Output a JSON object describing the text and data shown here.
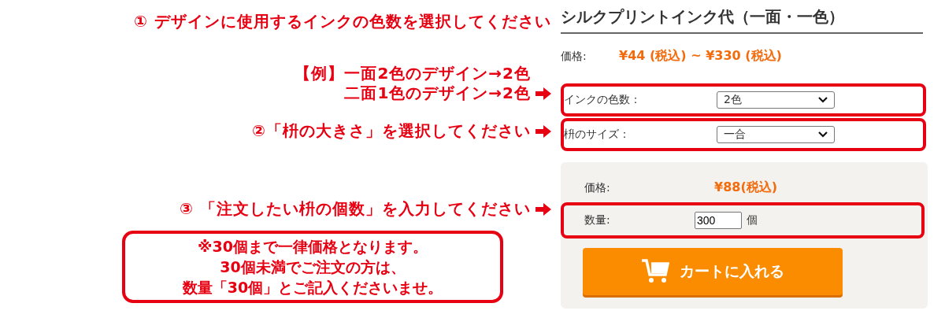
{
  "annotations": {
    "step1": "① デザインに使用するインクの色数を選択してください",
    "example_lines": [
      "【例】一面2色のデザイン→2色",
      "二面1色のデザイン→2色"
    ],
    "step2": "②「枡の大きさ」を選択してください",
    "step3": "③ 「注文したい枡の個数」を入力してください",
    "note_lines": [
      "※30個まで一律価格となります。",
      "30個未満でご注文の方は、",
      "数量「30個」とご記入くださいませ。"
    ]
  },
  "product": {
    "title": "シルクプリントインク代（一面・一色）",
    "price_label": "価格:",
    "price_range": "¥44 (税込) ~ ¥330 (税込)",
    "options": [
      {
        "label": "インクの色数：",
        "value": "2色"
      },
      {
        "label": "枡のサイズ：",
        "value": "一合"
      }
    ],
    "order": {
      "price_label": "価格:",
      "price": "¥88(税込)",
      "quantity_label": "数量:",
      "quantity": "300",
      "unit": "個",
      "cart_button": "カートに入れる"
    }
  }
}
